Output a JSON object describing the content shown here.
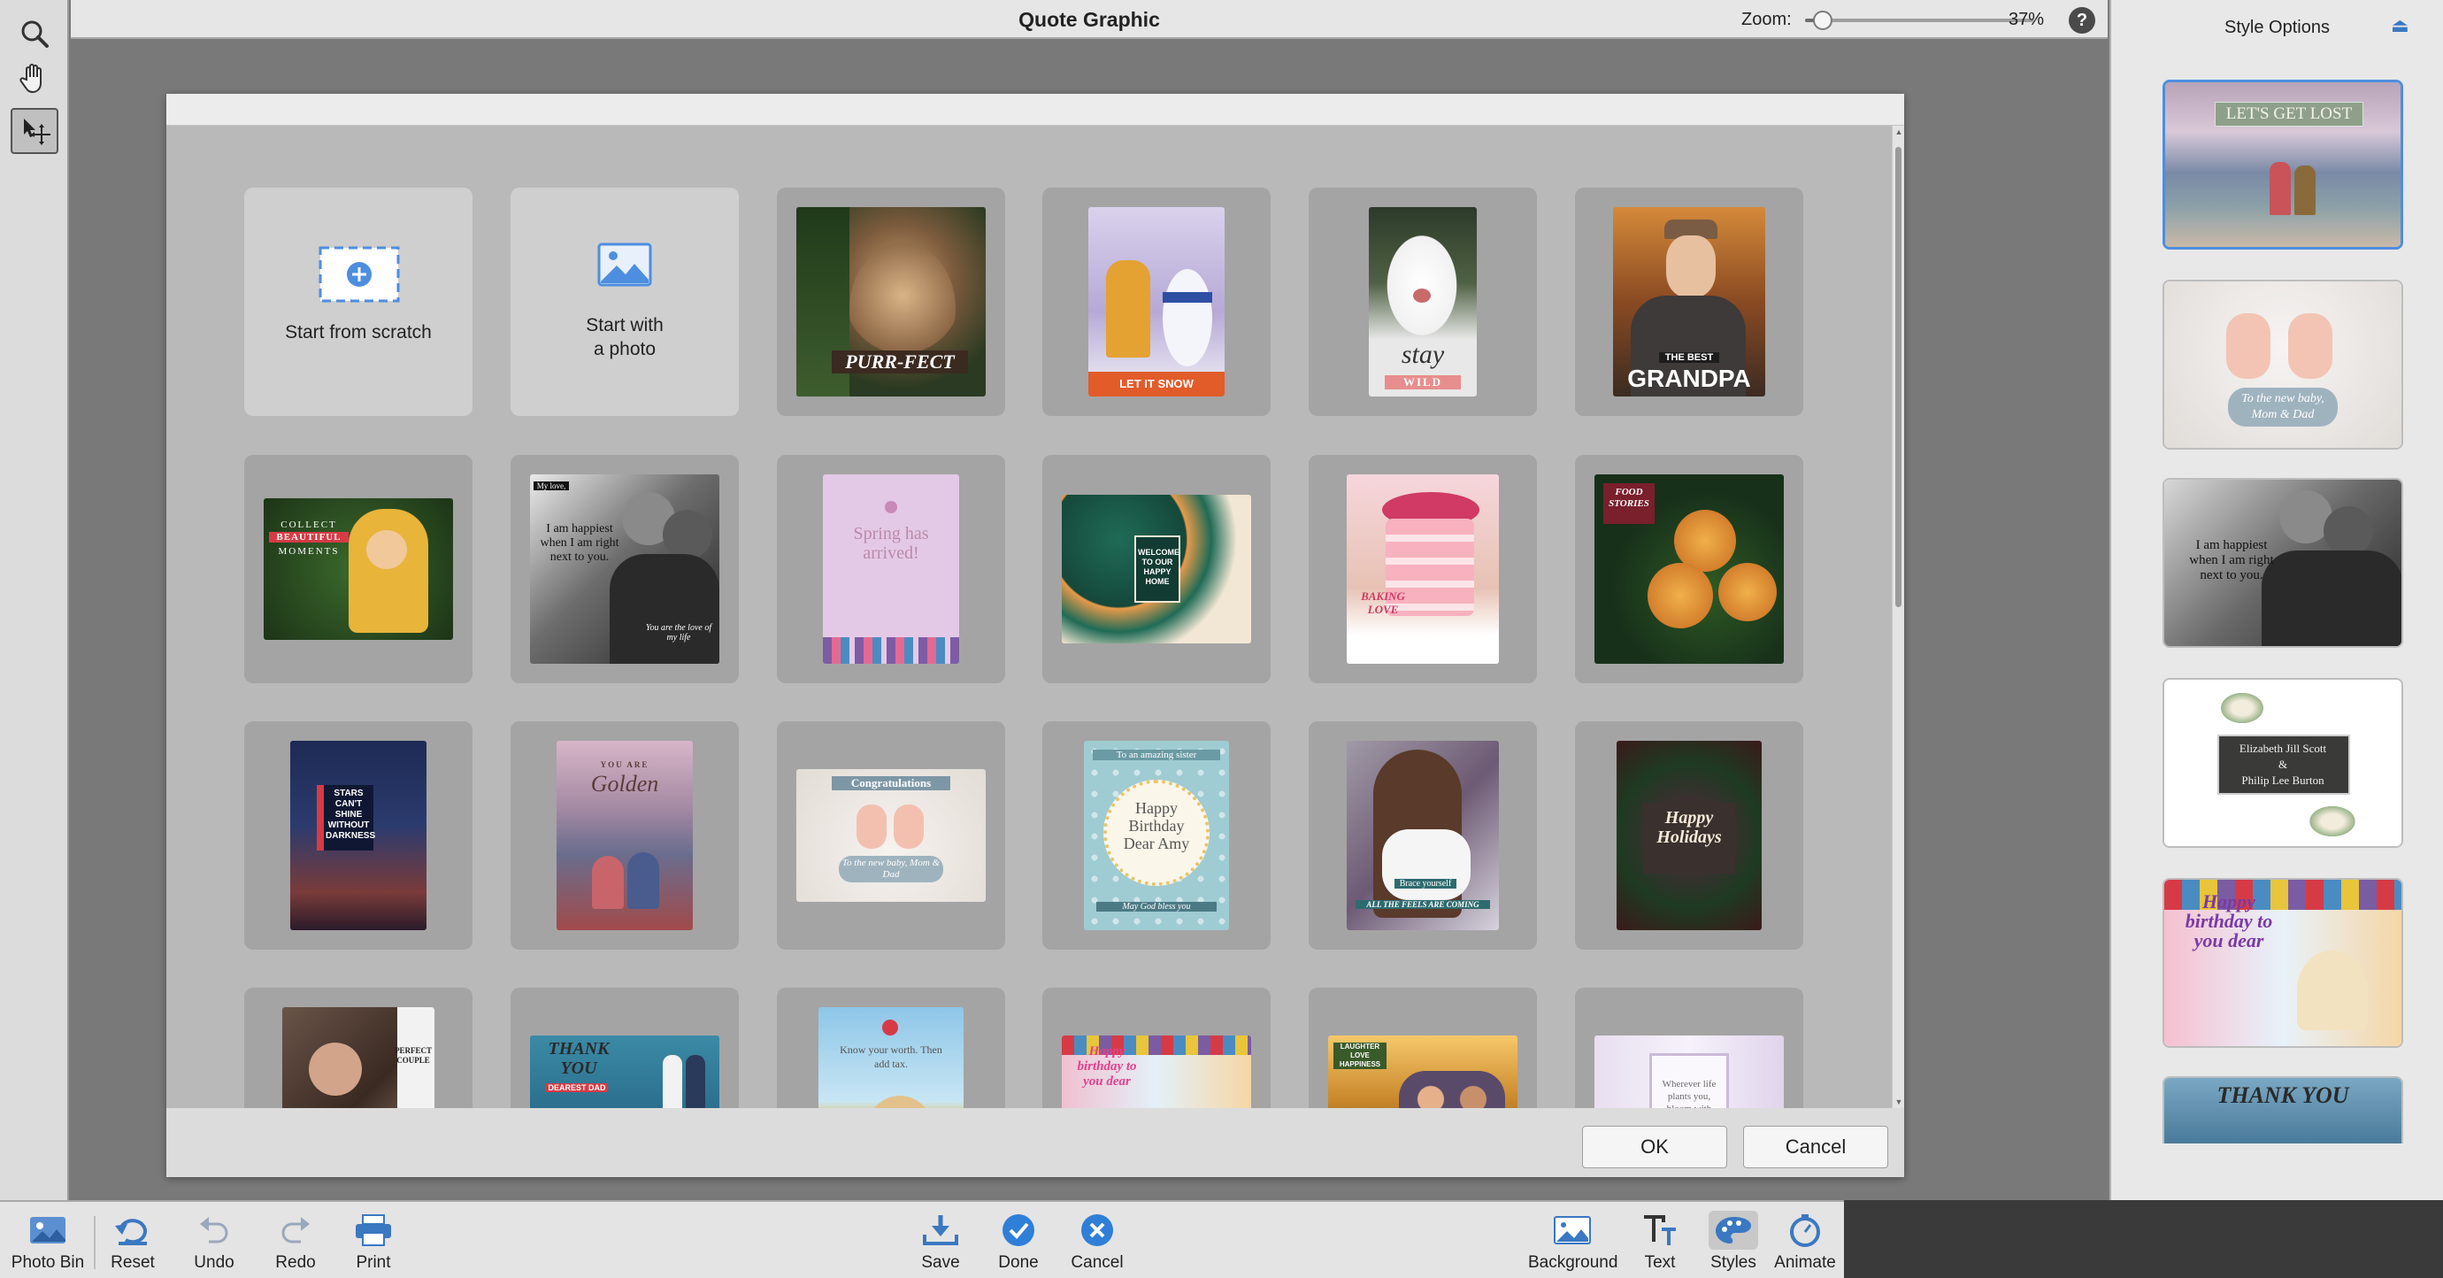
{
  "header": {
    "title": "Quote Graphic",
    "zoom_label": "Zoom:",
    "zoom_value": "37%",
    "zoom_fraction": 0.37,
    "help": "?"
  },
  "tools": [
    {
      "name": "zoom-tool",
      "icon": "magnifier-icon"
    },
    {
      "name": "hand-tool",
      "icon": "hand-icon"
    },
    {
      "name": "move-tool",
      "icon": "move-icon",
      "active": true
    }
  ],
  "grid": {
    "start_scratch": "Start from scratch",
    "start_photo_line1": "Start with",
    "start_photo_line2": "a photo",
    "captions": {
      "purrfect": "PURR-FECT",
      "let_it_snow": "LET IT SNOW",
      "stay": "stay",
      "wild": "WILD",
      "the_best": "THE BEST",
      "grandpa": "GRANDPA",
      "collect": "COLLECT",
      "beautiful": "BEAUTIFUL",
      "moments": "MOMENTS",
      "my_love": "My love,",
      "happiest": "I am happiest when I am right next to you.",
      "love_of_life": "You are the love of my life",
      "spring": "Spring has arrived!",
      "welcome": "WELCOME TO OUR HAPPY HOME",
      "baking_love": "BAKING LOVE",
      "food_stories": "FOOD STORIES",
      "stars": "STARS CAN'T SHINE WITHOUT DARKNESS",
      "you_are": "YOU ARE",
      "golden": "Golden",
      "congratulations": "Congratulations",
      "new_baby": "To the new baby, Mom & Dad",
      "amazing_sister": "To an amazing sister",
      "happy_bday_amy": "Happy Birthday Dear Amy",
      "god_bless": "May God bless you",
      "brace": "Brace yourself",
      "feels": "ALL THE FEELS ARE COMING",
      "happy_holidays": "Happy Holidays",
      "perfect_couple": "PERFECT COUPLE",
      "thank_you": "THANK YOU",
      "dearest_dad": "DEAREST DAD",
      "know_worth": "Know your worth. Then add tax.",
      "happy_bday_dear": "Happy birthday to you dear",
      "laughter": "LAUGHTER LOVE HAPPINESS",
      "wherever": "Wherever life plants you, bloom with grace"
    }
  },
  "dialog": {
    "ok": "OK",
    "cancel": "Cancel"
  },
  "right_panel": {
    "title": "Style Options",
    "cards": [
      {
        "text": "LET'S GET LOST"
      },
      {
        "text": "To the new baby, Mom & Dad"
      },
      {
        "text": "I am happiest when I am right next to you."
      },
      {
        "line1": "Elizabeth Jill Scott",
        "line2": "&",
        "line3": "Philip Lee Burton"
      },
      {
        "text": "Happy birthday to you dear"
      },
      {
        "text": "THANK YOU"
      }
    ]
  },
  "bottom_toolbar": {
    "photo_bin": "Photo Bin",
    "reset": "Reset",
    "undo": "Undo",
    "redo": "Redo",
    "print": "Print",
    "save": "Save",
    "done": "Done",
    "cancel": "Cancel",
    "background": "Background",
    "text": "Text",
    "styles": "Styles",
    "animate": "Animate"
  },
  "colors": {
    "accent": "#4d8ee0",
    "done_blue": "#2f7fd8",
    "cancel_blue": "#2f7fd8"
  }
}
